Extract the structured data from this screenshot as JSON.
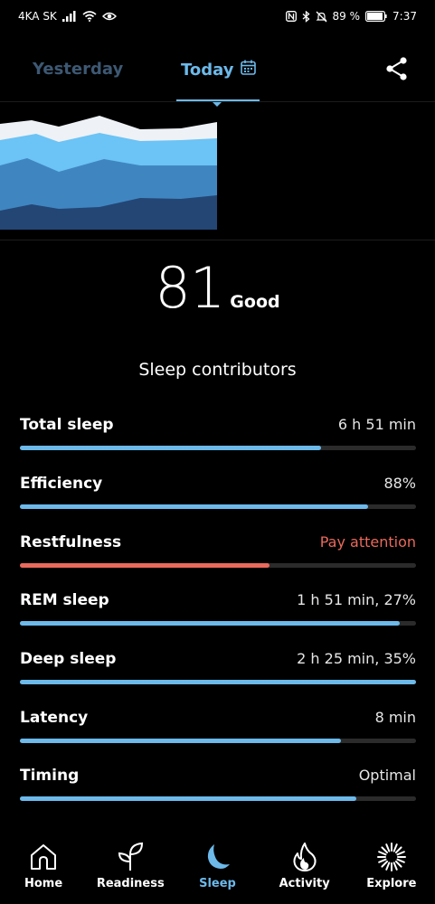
{
  "status_bar": {
    "carrier": "4KA SK",
    "battery_text": "89 %",
    "time": "7:37",
    "icons": [
      "signal-icon",
      "wifi-icon",
      "eye-icon",
      "nfc-icon",
      "bluetooth-icon",
      "mute-icon",
      "battery-icon"
    ]
  },
  "top_nav": {
    "tabs": [
      {
        "label": "Yesterday",
        "active": false
      },
      {
        "label": "Today",
        "active": true
      }
    ],
    "today_icon": "calendar-icon",
    "share_icon": "share-icon"
  },
  "colors": {
    "accent": "#6cb9ea",
    "warning": "#e9695c",
    "inactive_tab": "#3d5873",
    "awake": "#eef1f5",
    "rem": "#6cc3f5",
    "light": "#3f86c1",
    "deep": "#244675"
  },
  "score": {
    "value": "81",
    "label": "Good"
  },
  "contributors": {
    "title": "Sleep contributors",
    "items": [
      {
        "label": "Total sleep",
        "value": "6 h 51 min",
        "level": 0.76,
        "status": "normal"
      },
      {
        "label": "Efficiency",
        "value": "88%",
        "level": 0.88,
        "status": "normal"
      },
      {
        "label": "Restfulness",
        "value": "Pay attention",
        "level": 0.63,
        "status": "warning"
      },
      {
        "label": "REM sleep",
        "value": "1 h 51 min, 27%",
        "level": 0.96,
        "status": "normal"
      },
      {
        "label": "Deep sleep",
        "value": "2 h 25 min, 35%",
        "level": 1.0,
        "status": "normal"
      },
      {
        "label": "Latency",
        "value": "8 min",
        "level": 0.81,
        "status": "normal"
      },
      {
        "label": "Timing",
        "value": "Optimal",
        "level": 0.85,
        "status": "normal"
      }
    ]
  },
  "bottom_nav": {
    "items": [
      {
        "label": "Home",
        "icon": "home-icon",
        "active": false
      },
      {
        "label": "Readiness",
        "icon": "sprout-icon",
        "active": false
      },
      {
        "label": "Sleep",
        "icon": "moon-icon",
        "active": true
      },
      {
        "label": "Activity",
        "icon": "flame-icon",
        "active": false
      },
      {
        "label": "Explore",
        "icon": "sunburst-icon",
        "active": false
      }
    ]
  }
}
